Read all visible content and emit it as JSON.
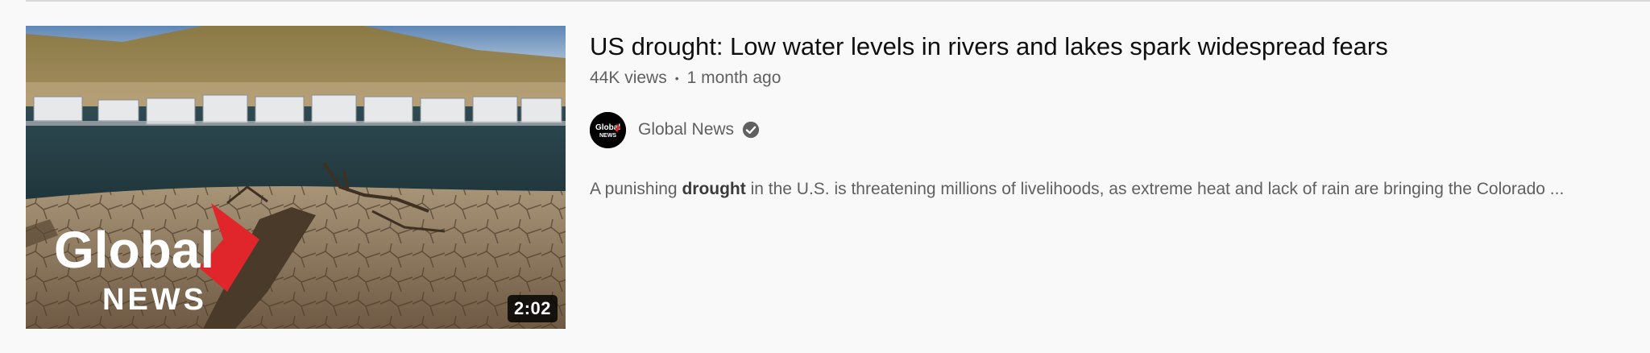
{
  "video": {
    "title": "US drought: Low water levels in rivers and lakes spark widespread fears",
    "views": "44K views",
    "age": "1 month ago",
    "duration": "2:02",
    "channel": {
      "name": "Global News",
      "verified_icon": "verified-check-icon",
      "avatar_text_top": "Global",
      "avatar_text_bottom": "NEWS"
    },
    "description": {
      "before": "A punishing ",
      "highlight": "drought",
      "after": " in the U.S. is threatening millions of livelihoods, as extreme heat and lack of rain are bringing the Colorado ..."
    },
    "thumbnail": {
      "logo_word": "Global",
      "logo_subword": "NEWS",
      "accent_color": "#e0262a"
    }
  }
}
